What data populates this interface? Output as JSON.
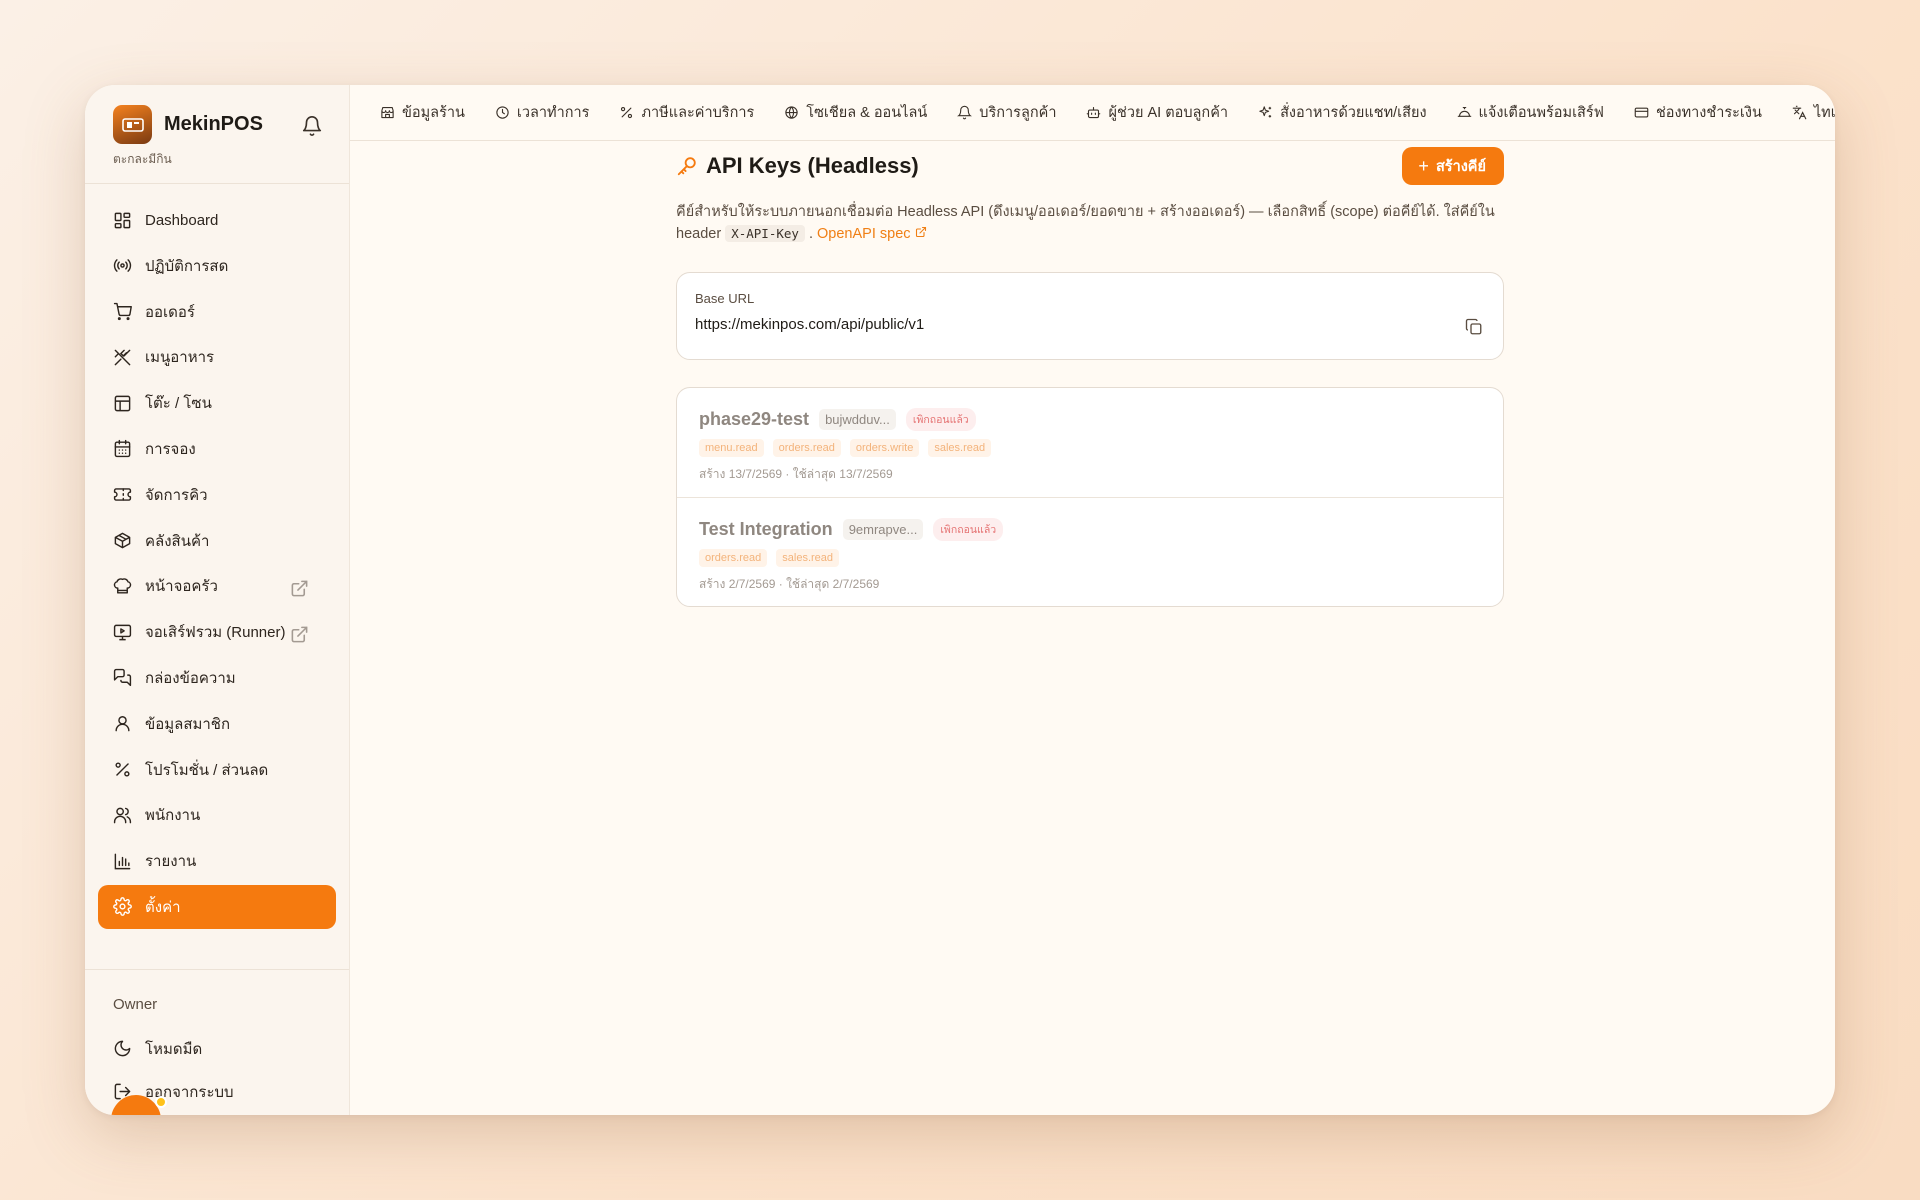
{
  "brand": {
    "name": "MekinPOS",
    "subtitle": "ตะกละมีกิน",
    "logo_text": "mekin POS"
  },
  "sidebar": {
    "items": [
      {
        "label": "Dashboard",
        "icon": "dashboard-icon"
      },
      {
        "label": "ปฏิบัติการสด",
        "icon": "broadcast-icon"
      },
      {
        "label": "ออเดอร์",
        "icon": "cart-icon"
      },
      {
        "label": "เมนูอาหาร",
        "icon": "utensils-icon"
      },
      {
        "label": "โต๊ะ / โซน",
        "icon": "table-icon"
      },
      {
        "label": "การจอง",
        "icon": "calendar-icon"
      },
      {
        "label": "จัดการคิว",
        "icon": "ticket-icon"
      },
      {
        "label": "คลังสินค้า",
        "icon": "package-icon"
      },
      {
        "label": "หน้าจอครัว",
        "icon": "chef-hat-icon",
        "external": true
      },
      {
        "label": "จอเสิร์ฟรวม (Runner)",
        "icon": "monitor-play-icon",
        "external": true
      },
      {
        "label": "กล่องข้อความ",
        "icon": "messages-icon"
      },
      {
        "label": "ข้อมูลสมาชิก",
        "icon": "user-icon"
      },
      {
        "label": "โปรโมชั่น / ส่วนลด",
        "icon": "percent-icon"
      },
      {
        "label": "พนักงาน",
        "icon": "users-icon"
      },
      {
        "label": "รายงาน",
        "icon": "bar-chart-icon"
      },
      {
        "label": "ตั้งค่า",
        "icon": "gear-icon",
        "active": true
      }
    ],
    "footer": {
      "owner_label": "Owner",
      "dark_mode": "โหมดมืด",
      "logout": "ออกจากระบบ"
    }
  },
  "tabs": [
    {
      "label": "ข้อมูลร้าน",
      "icon": "store-icon"
    },
    {
      "label": "เวลาทำการ",
      "icon": "clock-icon"
    },
    {
      "label": "ภาษีและค่าบริการ",
      "icon": "percent-icon"
    },
    {
      "label": "โซเชียล & ออนไลน์",
      "icon": "globe-icon"
    },
    {
      "label": "บริการลูกค้า",
      "icon": "bell-icon"
    },
    {
      "label": "ผู้ช่วย AI ตอบลูกค้า",
      "icon": "bot-icon"
    },
    {
      "label": "สั่งอาหารด้วยแชท/เสียง",
      "icon": "sparkles-icon"
    },
    {
      "label": "แจ้งเตือนพร้อมเสิร์ฟ",
      "icon": "cloche-icon"
    },
    {
      "label": "ช่องทางชำระเงิน",
      "icon": "credit-card-icon"
    },
    {
      "label": "ไทเ",
      "icon": "languages-icon"
    }
  ],
  "page": {
    "title": "API Keys (Headless)",
    "create_button": "สร้างคีย์",
    "description_before": "คีย์สำหรับให้ระบบภายนอกเชื่อมต่อ Headless API (ดึงเมนู/ออเดอร์/ยอดขาย + สร้างออเดอร์) — เลือกสิทธิ์ (scope) ต่อคีย์ได้. ใส่คีย์ใน header ",
    "header_code": "X-API-Key",
    "description_after": " . ",
    "openapi_link": "OpenAPI spec"
  },
  "base_url": {
    "label": "Base URL",
    "value": "https://mekinpos.com/api/public/v1"
  },
  "keys": [
    {
      "name": "phase29-test",
      "prefix": "bujwdduv...",
      "status": "เพิกถอนแล้ว",
      "scopes": [
        "menu.read",
        "orders.read",
        "orders.write",
        "sales.read"
      ],
      "meta": "สร้าง 13/7/2569 · ใช้ล่าสุด 13/7/2569"
    },
    {
      "name": "Test Integration",
      "prefix": "9emrapve...",
      "status": "เพิกถอนแล้ว",
      "scopes": [
        "orders.read",
        "sales.read"
      ],
      "meta": "สร้าง 2/7/2569 · ใช้ล่าสุด 2/7/2569"
    }
  ],
  "colors": {
    "accent": "#f57a0f",
    "revoked": "#e57373"
  }
}
